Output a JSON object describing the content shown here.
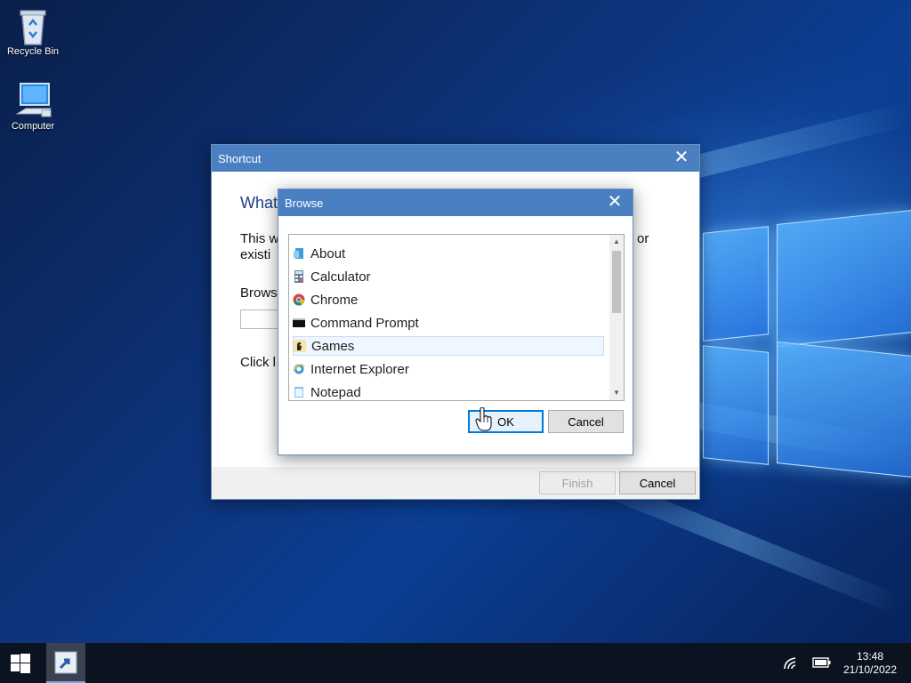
{
  "desktop": {
    "icons": [
      {
        "label": "Recycle Bin",
        "icon": "recycle-bin-icon"
      },
      {
        "label": "Computer",
        "icon": "computer-icon"
      }
    ]
  },
  "shortcut_dialog": {
    "title": "Shortcut",
    "heading": "What",
    "desc_line1": "This w",
    "desc_line1_tail": "or",
    "desc_line2": "existi",
    "browse_label": "Brows",
    "click_text": "Click l",
    "finish_label": "Finish",
    "cancel_label": "Cancel"
  },
  "browse_dialog": {
    "title": "Browse",
    "items": [
      {
        "label": "About",
        "icon": "about-icon"
      },
      {
        "label": "Calculator",
        "icon": "calculator-icon"
      },
      {
        "label": "Chrome",
        "icon": "chrome-icon"
      },
      {
        "label": "Command Prompt",
        "icon": "command-prompt-icon"
      },
      {
        "label": "Games",
        "icon": "games-icon",
        "selected": true
      },
      {
        "label": "Internet Explorer",
        "icon": "internet-explorer-icon"
      },
      {
        "label": "Notepad",
        "icon": "notepad-icon"
      }
    ],
    "ok_label": "OK",
    "cancel_label": "Cancel"
  },
  "taskbar": {
    "time": "13:48",
    "date": "21/10/2022"
  }
}
